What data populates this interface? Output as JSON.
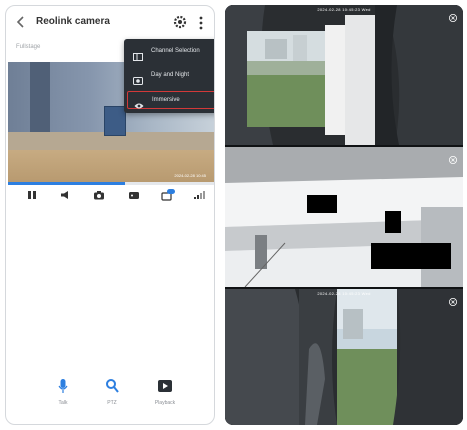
{
  "app": {
    "title": "Reolink camera",
    "status": "Fullstage"
  },
  "colors": {
    "accent": "#2d7fe0",
    "menu_bg": "#2b3036",
    "highlight_border": "#d23939"
  },
  "video": {
    "timestamp": "2024-02-28 10:45"
  },
  "menu": {
    "items": [
      {
        "label": "Channel Selection",
        "icon": "grid-icon"
      },
      {
        "label": "Day and Night",
        "icon": "image-icon"
      },
      {
        "label": "Immersive",
        "icon": "eye-icon",
        "highlighted": true
      }
    ]
  },
  "controls": [
    {
      "icon": "pause-icon"
    },
    {
      "icon": "volume-icon"
    },
    {
      "icon": "camera-icon"
    },
    {
      "icon": "record-icon"
    },
    {
      "icon": "quality-icon",
      "badge": "HD"
    },
    {
      "icon": "signal-icon"
    }
  ],
  "bottom_actions": [
    {
      "label": "Talk",
      "icon": "microphone-icon"
    },
    {
      "label": "PTZ",
      "icon": "zoom-icon"
    },
    {
      "label": "Playback",
      "icon": "playback-icon"
    }
  ],
  "feeds": [
    {
      "timestamp": "2024-02-28 10:45:23 Wed"
    },
    {
      "timestamp": ""
    },
    {
      "timestamp": "2024-02-28 10:45:23 Wed"
    }
  ],
  "progress": 0.57
}
